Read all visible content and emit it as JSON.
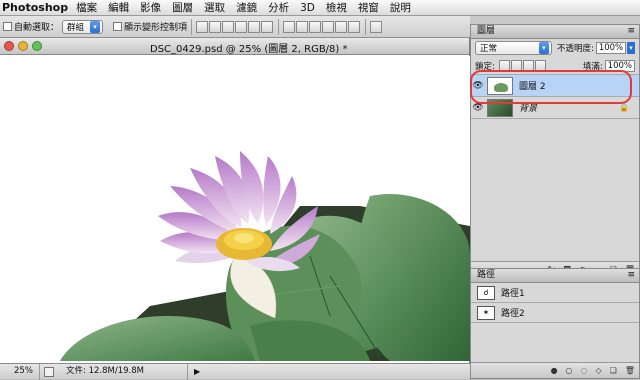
{
  "menubar": {
    "app": "Photoshop",
    "items": [
      "檔案",
      "編輯",
      "影像",
      "圖層",
      "選取",
      "濾鏡",
      "分析",
      "3D",
      "檢視",
      "視窗",
      "說明"
    ]
  },
  "options": {
    "auto_select_label": "自動選取：",
    "auto_select_value": "群組",
    "show_transform_label": "顯示變形控制項"
  },
  "document": {
    "title": "DSC_0429.psd @ 25% (圖層 2, RGB/8) *",
    "zoom": "25%",
    "doc_size": "文件: 12.8M/19.8M"
  },
  "layers_panel": {
    "tab": "圖層",
    "blend_mode": "正常",
    "opacity_label": "不透明度:",
    "opacity_value": "100%",
    "lock_label": "鎖定:",
    "fill_label": "填滿:",
    "fill_value": "100%",
    "layers": [
      {
        "name": "圖層 2",
        "selected": true
      },
      {
        "name": "背景",
        "selected": false,
        "locked": true
      }
    ]
  },
  "paths_panel": {
    "tab": "路徑",
    "paths": [
      "路徑1",
      "路徑2"
    ]
  },
  "colors": {
    "selection": "#b7d3f5",
    "highlight": "#e23a3a"
  }
}
